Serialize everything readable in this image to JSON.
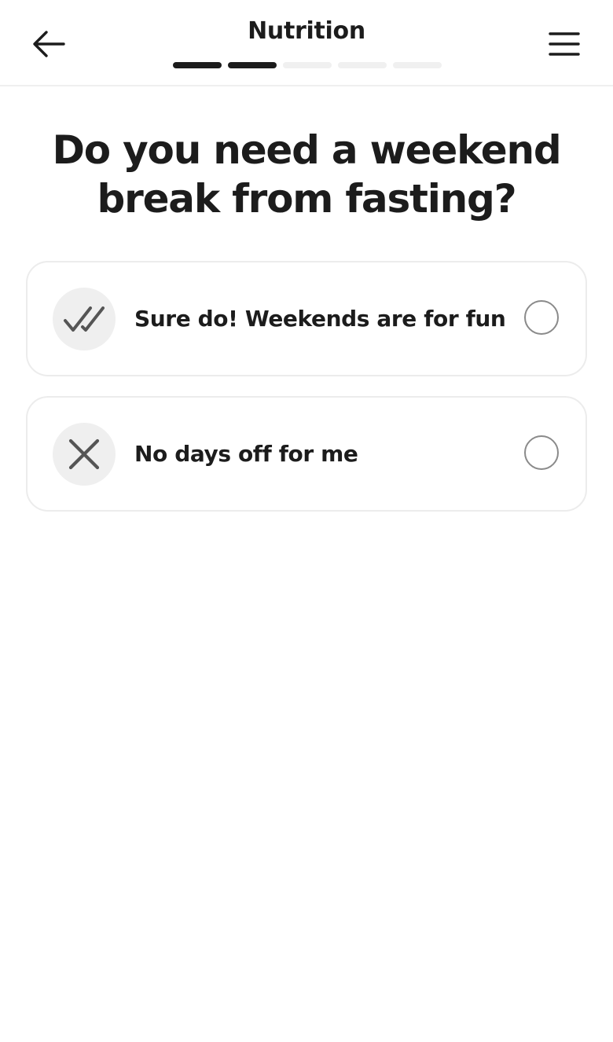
{
  "header": {
    "title": "Nutrition",
    "back_icon": "arrow-left-icon",
    "menu_icon": "hamburger-menu-icon",
    "progress": {
      "completed_steps": 2,
      "total_steps": 5
    }
  },
  "question": {
    "line1": "Do you need a weekend",
    "line2": "break from fasting?"
  },
  "options": [
    {
      "label": "Sure do! Weekends are for fun",
      "icon": "double-check-icon",
      "selected": false
    },
    {
      "label": "No days off for me",
      "icon": "close-x-icon",
      "selected": false
    }
  ],
  "colors": {
    "text": "#1c1c1c",
    "progress_done": "#1c1c1c",
    "progress_pending": "#f0f0f0",
    "icon_bg": "#efefef",
    "card_border": "#ececec",
    "radio_border": "#8a8a8a"
  }
}
